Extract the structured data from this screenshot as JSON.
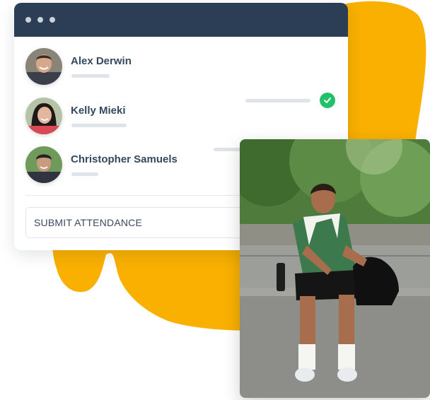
{
  "brand_colors": {
    "accent_orange": "#f9b000",
    "titlebar": "#2c3e56",
    "check_green": "#22c068"
  },
  "window": {
    "titlebar_icons": [
      "dot-icon",
      "dot-icon",
      "dot-icon"
    ]
  },
  "attendance": {
    "rows": [
      {
        "name": "Alex Derwin",
        "checked": true
      },
      {
        "name": "Kelly Mieki",
        "checked": true
      },
      {
        "name": "Christopher Samuels",
        "checked": false
      }
    ],
    "submit_label": "SUBMIT ATTENDANCE"
  }
}
